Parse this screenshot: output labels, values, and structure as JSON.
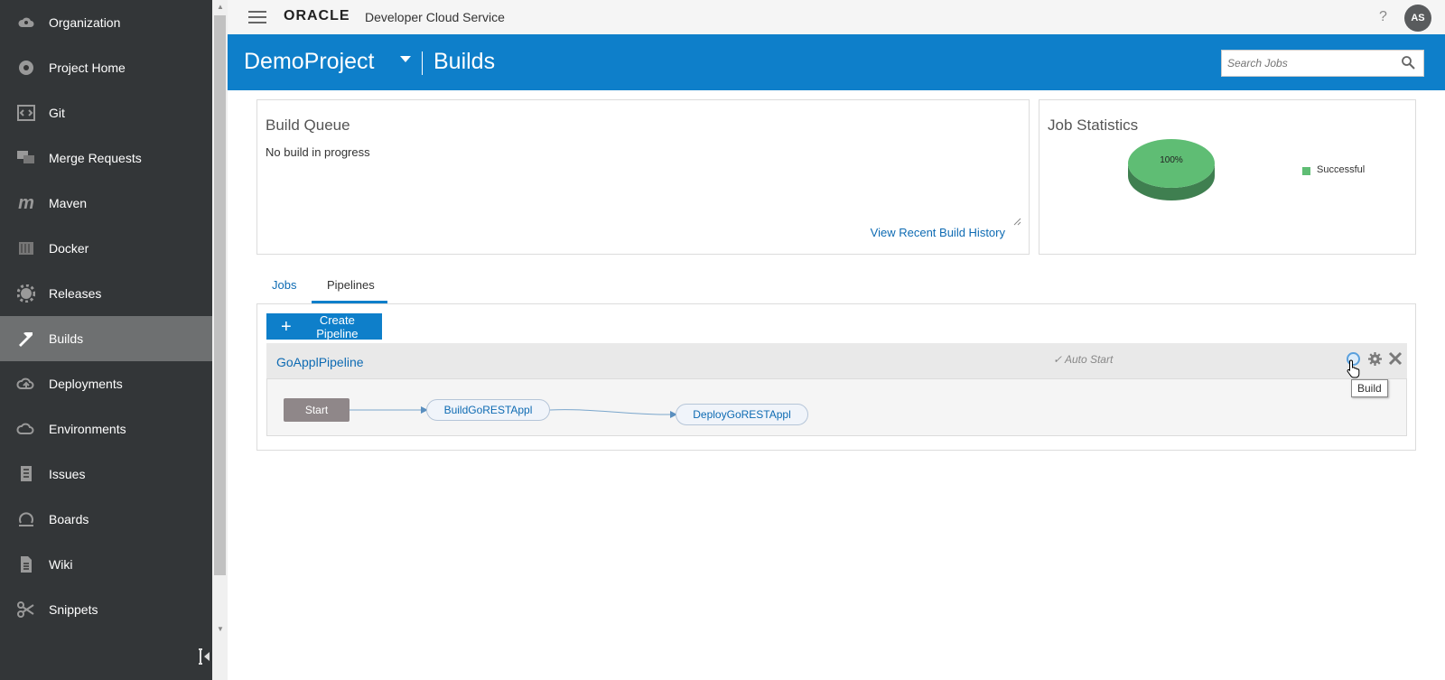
{
  "sidebar": {
    "items": [
      {
        "label": "Organization",
        "icon": "organization-icon"
      },
      {
        "label": "Project Home",
        "icon": "project-home-icon"
      },
      {
        "label": "Git",
        "icon": "git-icon"
      },
      {
        "label": "Merge Requests",
        "icon": "merge-requests-icon"
      },
      {
        "label": "Maven",
        "icon": "maven-icon"
      },
      {
        "label": "Docker",
        "icon": "docker-icon"
      },
      {
        "label": "Releases",
        "icon": "releases-icon"
      },
      {
        "label": "Builds",
        "icon": "builds-icon",
        "active": true
      },
      {
        "label": "Deployments",
        "icon": "deployments-icon"
      },
      {
        "label": "Environments",
        "icon": "environments-icon"
      },
      {
        "label": "Issues",
        "icon": "issues-icon"
      },
      {
        "label": "Boards",
        "icon": "boards-icon"
      },
      {
        "label": "Wiki",
        "icon": "wiki-icon"
      },
      {
        "label": "Snippets",
        "icon": "snippets-icon"
      }
    ]
  },
  "topbar": {
    "brand_oracle": "ORACLE",
    "brand_product": "Developer Cloud Service",
    "help": "?",
    "avatar_initials": "AS"
  },
  "header": {
    "project": "DemoProject",
    "section": "Builds",
    "search_placeholder": "Search Jobs"
  },
  "build_queue": {
    "title": "Build Queue",
    "empty_text": "No build in progress",
    "history_link": "View Recent Build History"
  },
  "job_statistics": {
    "title": "Job Statistics",
    "legend_label": "Successful",
    "legend_color": "#5fbd74"
  },
  "chart_data": {
    "type": "pie",
    "categories": [
      "Successful"
    ],
    "values": [
      100
    ],
    "data_labels": [
      "100%"
    ],
    "colors": [
      "#5fbd74"
    ],
    "legend_placement": "right"
  },
  "tabs": {
    "jobs": "Jobs",
    "pipelines": "Pipelines",
    "active": "pipelines"
  },
  "pipelines": {
    "create_button": "Create Pipeline",
    "items": [
      {
        "name": "GoApplPipeline",
        "auto_start": "Auto Start",
        "tooltip": "Build",
        "nodes": {
          "start": "Start",
          "build": "BuildGoRESTAppl",
          "deploy": "DeployGoRESTAppl"
        }
      }
    ]
  },
  "colors": {
    "accent": "#0e7fca",
    "sidebar_bg": "#333638",
    "sidebar_active": "#6e7071",
    "link": "#0e6bb3"
  }
}
